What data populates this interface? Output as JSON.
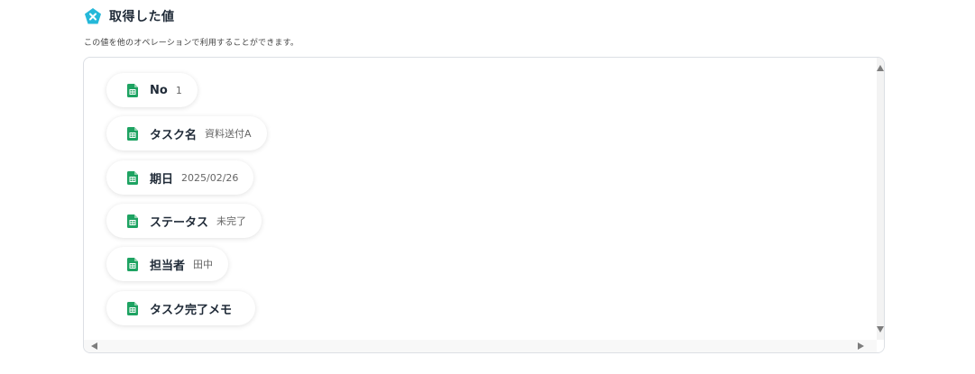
{
  "header": {
    "title": "取得した値",
    "icon": "variable-x-icon",
    "icon_color": "#25b8d9"
  },
  "subtitle": "この値を他のオペレーションで利用することができます。",
  "chips": [
    {
      "key": "No",
      "value": "1",
      "icon": "google-sheets-icon"
    },
    {
      "key": "タスク名",
      "value": "資料送付A",
      "icon": "google-sheets-icon"
    },
    {
      "key": "期日",
      "value": "2025/02/26",
      "icon": "google-sheets-icon"
    },
    {
      "key": "ステータス",
      "value": "未完了",
      "icon": "google-sheets-icon"
    },
    {
      "key": "担当者",
      "value": "田中",
      "icon": "google-sheets-icon"
    },
    {
      "key": "タスク完了メモ",
      "value": "",
      "icon": "google-sheets-icon"
    }
  ],
  "colors": {
    "sheets_green": "#1ea362",
    "chip_key": "#1f2a37",
    "chip_value": "#666666"
  }
}
